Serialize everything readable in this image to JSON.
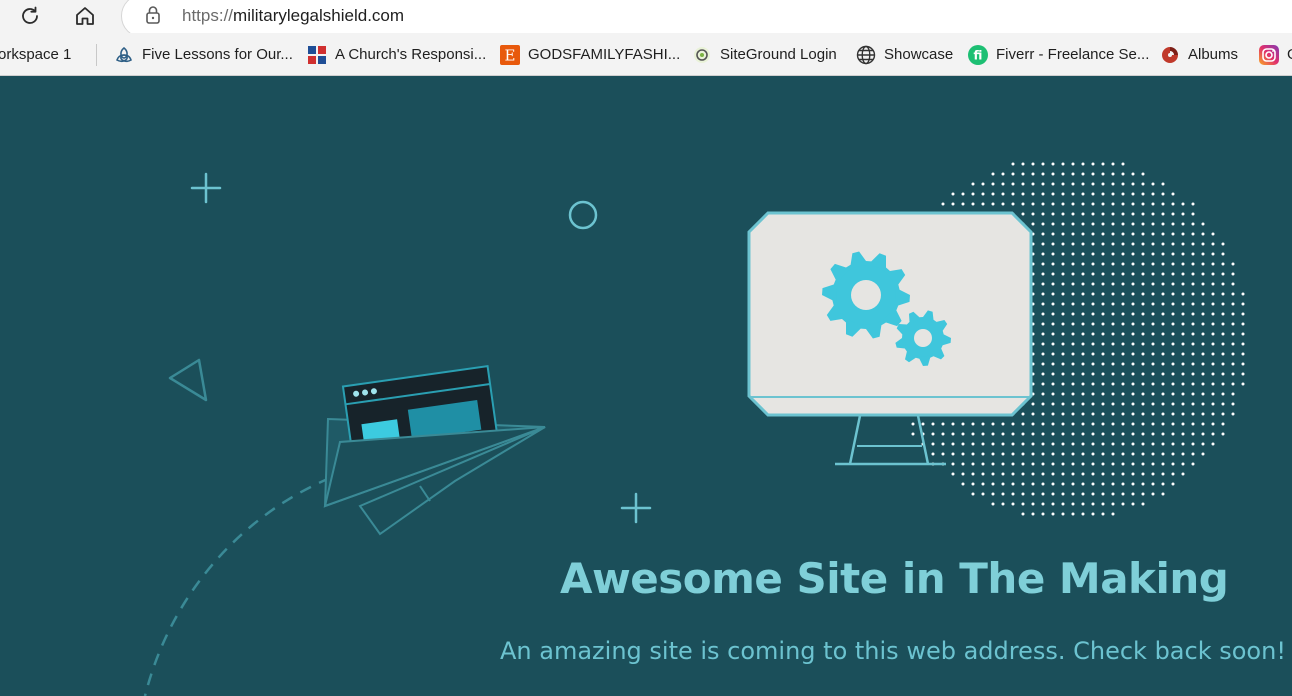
{
  "browser": {
    "url_scheme": "https://",
    "url_host": "militarylegalshield.com",
    "icons": {
      "reload": "reload-icon",
      "home": "home-icon",
      "lock": "lock-icon"
    }
  },
  "bookmarks": [
    {
      "label": "orkspace 1",
      "icon": "workspace"
    },
    {
      "label": "Five Lessons for Our...",
      "icon": "trinity-knot-icon"
    },
    {
      "label": "A Church's Responsi...",
      "icon": "grid-logo-icon"
    },
    {
      "label": "GODSFAMILYFASHI...",
      "icon": "etsy-icon"
    },
    {
      "label": "SiteGround Login",
      "icon": "siteground-icon"
    },
    {
      "label": "Showcase",
      "icon": "globe-icon"
    },
    {
      "label": "Fiverr - Freelance Se...",
      "icon": "fiverr-icon"
    },
    {
      "label": "Albums",
      "icon": "albums-icon"
    },
    {
      "label": "G",
      "icon": "instagram-icon"
    }
  ],
  "page": {
    "headline": "Awesome Site in The Making",
    "subline": "An amazing site is coming to this web address. Check back soon!"
  },
  "colors": {
    "background": "#1b4f5a",
    "accent": "#7fcfd8",
    "gear": "#3fc6dc",
    "monitor": "#e6e5e2"
  }
}
